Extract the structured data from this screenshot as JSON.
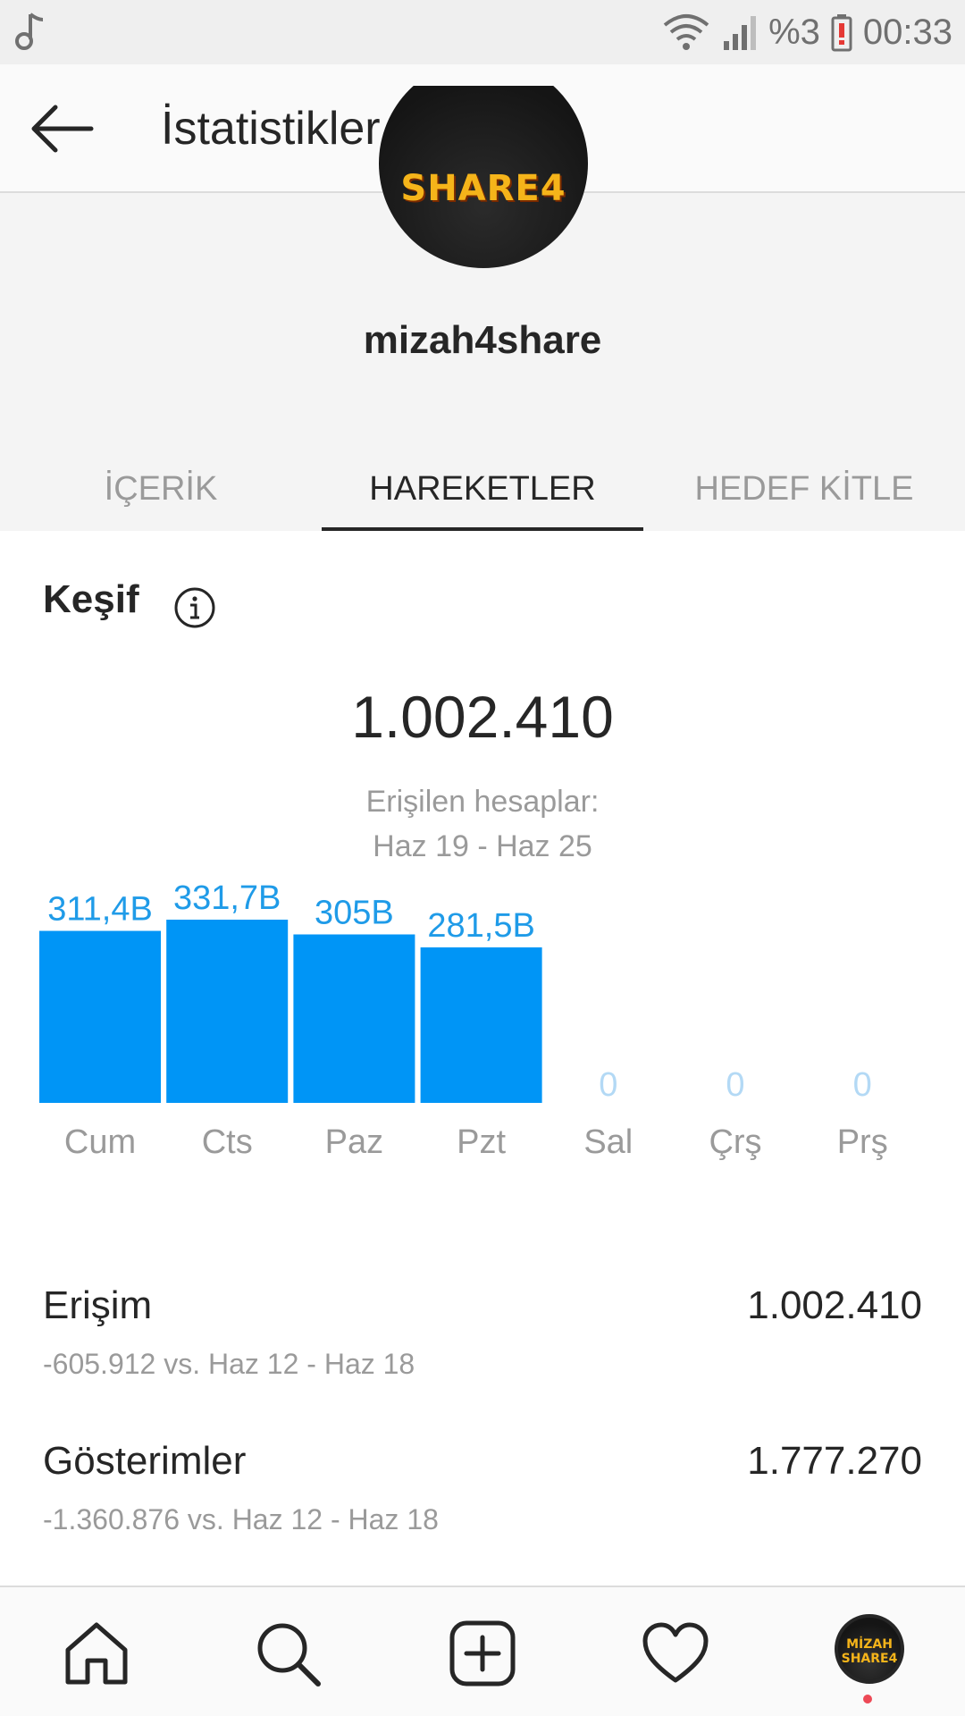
{
  "status_bar": {
    "battery_text": "%3",
    "time": "00:33",
    "icons": [
      "music-note-icon",
      "wifi-icon",
      "signal-icon",
      "battery-alert-icon"
    ]
  },
  "app_bar": {
    "title": "İstatistikler",
    "back_icon": "arrow-left-icon"
  },
  "profile": {
    "avatar_logo_text": "SHARE4",
    "username": "mizah4share"
  },
  "tabs": [
    {
      "label": "İÇERİK",
      "active": false
    },
    {
      "label": "HAREKETLER",
      "active": true
    },
    {
      "label": "HEDEF KİTLE",
      "active": false
    }
  ],
  "discovery": {
    "title": "Keşif",
    "total": "1.002.410",
    "subtitle_line1": "Erişilen hesaplar:",
    "subtitle_line2": "Haz 19 - Haz 25"
  },
  "chart_data": {
    "type": "bar",
    "categories": [
      "Cum",
      "Cts",
      "Paz",
      "Pzt",
      "Sal",
      "Çrş",
      "Prş"
    ],
    "values": [
      311400,
      331700,
      305000,
      281500,
      0,
      0,
      0
    ],
    "value_labels": [
      "311,4B",
      "331,7B",
      "305B",
      "281,5B",
      "0",
      "0",
      "0"
    ],
    "bar_color": "#0095f6",
    "label_color": "#1f9be8",
    "zero_label_color": "#b3d9f5",
    "axis_label_color": "#9a9a9a"
  },
  "metrics": [
    {
      "label": "Erişim",
      "value": "1.002.410",
      "sub": "-605.912 vs. Haz 12 - Haz 18"
    },
    {
      "label": "Gösterimler",
      "value": "1.777.270",
      "sub": "-1.360.876 vs. Haz 12 - Haz 18"
    }
  ],
  "bottom_nav": {
    "items": [
      "home-icon",
      "search-icon",
      "add-post-icon",
      "heart-icon",
      "profile-avatar"
    ],
    "avatar_text": "MİZAH SHARE4",
    "notification_dot_color": "#ed4956"
  }
}
